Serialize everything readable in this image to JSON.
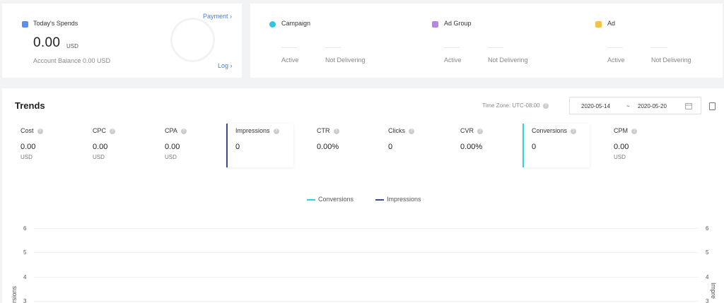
{
  "spends": {
    "title": "Today's Spends",
    "amount": "0.00",
    "currency": "USD",
    "balance": "Account Balance 0.00 USD",
    "payment_link": "Payment ›",
    "log_link": "Log ›",
    "icon_color": "#5b8ef0"
  },
  "stats": [
    {
      "label": "Campaign",
      "icon": "campaign-icon",
      "color": "#2ec7e0",
      "active": "Active",
      "not_delivering": "Not Delivering"
    },
    {
      "label": "Ad Group",
      "icon": "ad-group-icon",
      "color": "#b784e8",
      "active": "Active",
      "not_delivering": "Not Delivering"
    },
    {
      "label": "Ad",
      "icon": "ad-icon",
      "color": "#f5c242",
      "active": "Active",
      "not_delivering": "Not Delivering"
    }
  ],
  "trends": {
    "title": "Trends",
    "timezone": "Time Zone: UTC-08:00",
    "date_start": "2020-05-14",
    "date_sep": "~",
    "date_end": "2020-05-20"
  },
  "metrics": [
    {
      "label": "Cost",
      "value": "0.00",
      "unit": "USD",
      "selected": false
    },
    {
      "label": "CPC",
      "value": "0.00",
      "unit": "USD",
      "selected": false
    },
    {
      "label": "CPA",
      "value": "0.00",
      "unit": "USD",
      "selected": false
    },
    {
      "label": "Impressions",
      "value": "0",
      "unit": "",
      "selected": true,
      "color": "#3a4a8a"
    },
    {
      "label": "CTR",
      "value": "0.00%",
      "unit": "",
      "selected": false
    },
    {
      "label": "Clicks",
      "value": "0",
      "unit": "",
      "selected": false
    },
    {
      "label": "CVR",
      "value": "0.00%",
      "unit": "",
      "selected": false
    },
    {
      "label": "Conversions",
      "value": "0",
      "unit": "",
      "selected": true,
      "color": "#2ed3e0"
    },
    {
      "label": "CPM",
      "value": "0.00",
      "unit": "USD",
      "selected": false
    }
  ],
  "chart": {
    "legend": [
      {
        "name": "Conversions",
        "color": "#2ed3e0"
      },
      {
        "name": "Impressions",
        "color": "#3a4a8a"
      }
    ],
    "y_ticks": [
      "6",
      "5",
      "4",
      "3"
    ],
    "left_axis_label": "rsions",
    "right_axis_label": "Impre"
  }
}
